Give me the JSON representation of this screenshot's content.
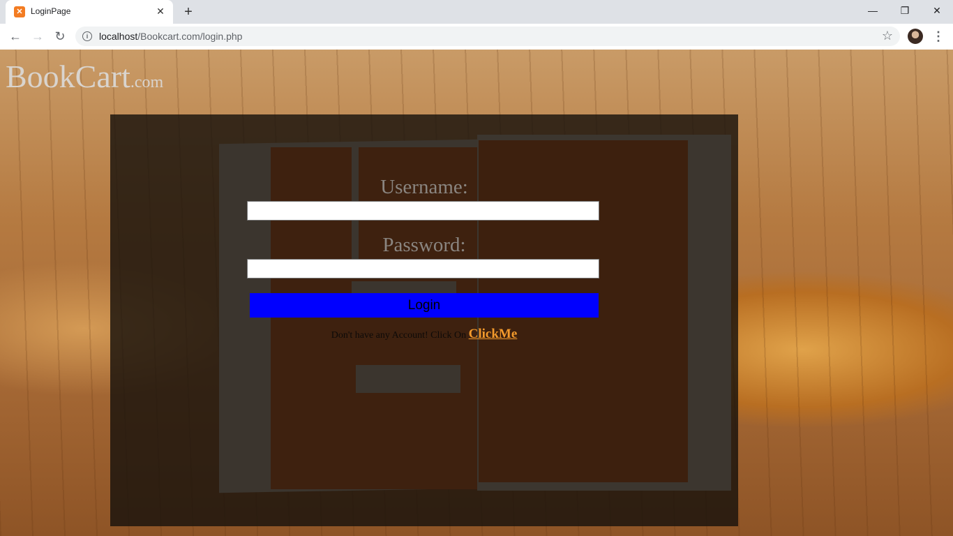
{
  "browser": {
    "tab_title": "LoginPage",
    "tab_favicon": "xampp-icon",
    "url_host": "localhost",
    "url_path": "/Bookcart.com/login.php"
  },
  "page": {
    "brand_main": "BookCart",
    "brand_suffix": ".com",
    "username_label": "Username:",
    "username_value": "",
    "password_label": "Password:",
    "password_value": "",
    "login_label": "Login",
    "signup_prompt": "Don't have any Account! Click On",
    "signup_link": "ClickMe"
  },
  "colors": {
    "login_button": "#0000ff",
    "signup_link": "#f39a2c",
    "favicon": "#f37c22"
  }
}
